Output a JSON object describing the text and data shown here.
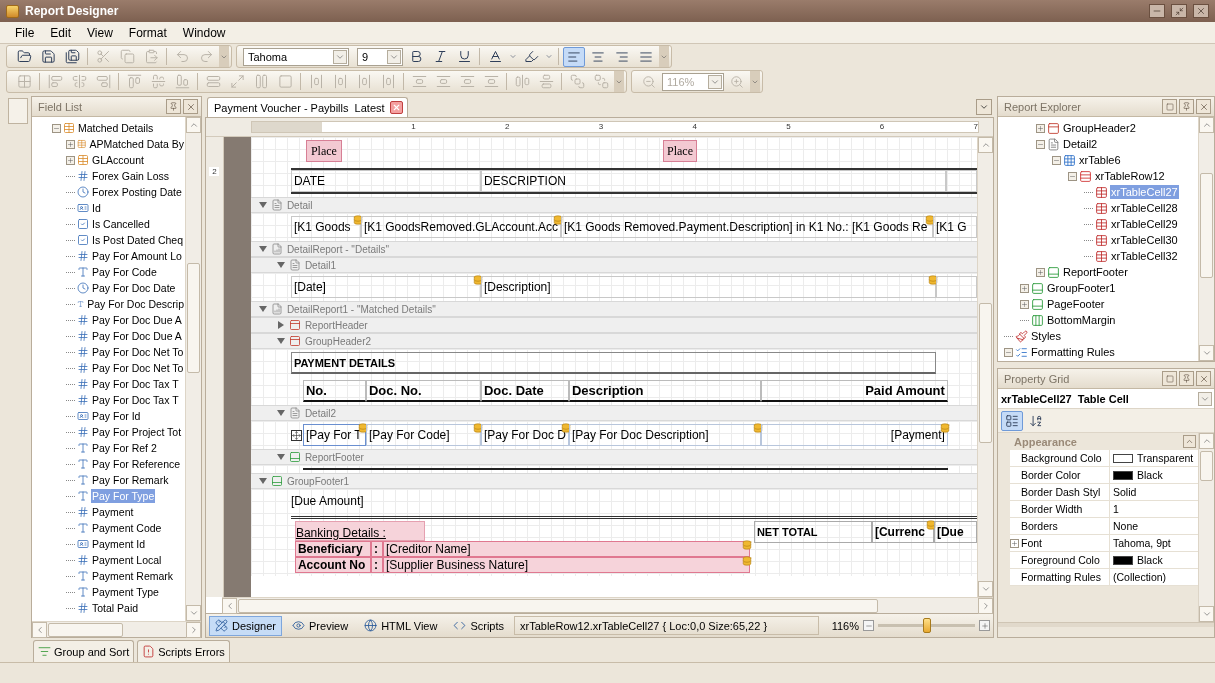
{
  "window": {
    "title": "Report Designer"
  },
  "menu": [
    "File",
    "Edit",
    "View",
    "Format",
    "Window"
  ],
  "file_tools": [
    {
      "kind": "open",
      "disabled": false
    },
    {
      "kind": "save",
      "disabled": false
    },
    {
      "kind": "save-all",
      "disabled": false
    },
    {
      "kind": "separator"
    },
    {
      "kind": "cut",
      "disabled": true
    },
    {
      "kind": "copy",
      "disabled": true
    },
    {
      "kind": "paste",
      "disabled": true
    },
    {
      "kind": "separator"
    },
    {
      "kind": "undo",
      "disabled": true
    },
    {
      "kind": "redo",
      "disabled": true
    }
  ],
  "font": {
    "name": "Tahoma",
    "size": "9"
  },
  "format_tools": [
    {
      "kind": "bold",
      "disabled": false
    },
    {
      "kind": "italic",
      "disabled": false
    },
    {
      "kind": "underline",
      "disabled": false
    },
    {
      "kind": "separator"
    },
    {
      "kind": "font-color",
      "disabled": false
    },
    {
      "kind": "dropdown",
      "disabled": false
    },
    {
      "kind": "back-color",
      "disabled": false
    },
    {
      "kind": "dropdown",
      "disabled": false
    },
    {
      "kind": "separator"
    }
  ],
  "alignment": [
    {
      "kind": "left",
      "selected": true
    },
    {
      "kind": "center",
      "selected": false
    },
    {
      "kind": "right",
      "selected": false
    },
    {
      "kind": "justify",
      "selected": false
    }
  ],
  "layout_tools": [
    {
      "kind": "grid",
      "disabled": true
    },
    {
      "kind": "separator"
    },
    {
      "kind": "align-left",
      "disabled": true
    },
    {
      "kind": "align-center",
      "disabled": true
    },
    {
      "kind": "align-right",
      "disabled": true
    },
    {
      "kind": "separator"
    },
    {
      "kind": "align-top",
      "disabled": true
    },
    {
      "kind": "align-middle",
      "disabled": true
    },
    {
      "kind": "align-bottom",
      "disabled": true
    },
    {
      "kind": "separator"
    },
    {
      "kind": "same-width",
      "disabled": true
    },
    {
      "kind": "size-grid",
      "disabled": true
    },
    {
      "kind": "same-height",
      "disabled": true
    },
    {
      "kind": "same-size",
      "disabled": true
    },
    {
      "kind": "separator"
    },
    {
      "kind": "h-space",
      "disabled": true
    },
    {
      "kind": "h-space",
      "disabled": true
    },
    {
      "kind": "h-space",
      "disabled": true
    },
    {
      "kind": "h-space",
      "disabled": true
    },
    {
      "kind": "separator"
    },
    {
      "kind": "v-space",
      "disabled": true
    },
    {
      "kind": "v-space",
      "disabled": true
    },
    {
      "kind": "v-space",
      "disabled": true
    },
    {
      "kind": "v-space",
      "disabled": true
    },
    {
      "kind": "separator"
    },
    {
      "kind": "center-h",
      "disabled": true
    },
    {
      "kind": "center-v",
      "disabled": true
    },
    {
      "kind": "separator"
    },
    {
      "kind": "front",
      "disabled": true
    },
    {
      "kind": "back",
      "disabled": true
    }
  ],
  "zoom_tool": {
    "value": "116%",
    "disabled": true
  },
  "field_list": {
    "title": "Field List",
    "tree": [
      {
        "label": "Matched Details",
        "kind": "table",
        "expanded": true,
        "selected": false,
        "children": [
          {
            "label": "APMatched Data By",
            "kind": "table",
            "expanded": false,
            "selected": false
          },
          {
            "label": "GLAccount",
            "kind": "table",
            "expanded": false,
            "selected": false
          },
          {
            "label": "Forex Gain Loss",
            "kind": "number",
            "selected": false
          },
          {
            "label": "Forex Posting Date",
            "kind": "date",
            "selected": false
          },
          {
            "label": "Id",
            "kind": "id",
            "selected": false
          },
          {
            "label": "Is Cancelled",
            "kind": "bool",
            "selected": false
          },
          {
            "label": "Is Post Dated Cheq",
            "kind": "bool",
            "selected": false
          },
          {
            "label": "Pay For Amount Lo",
            "kind": "number",
            "selected": false
          },
          {
            "label": "Pay For Code",
            "kind": "text",
            "selected": false
          },
          {
            "label": "Pay For Doc Date",
            "kind": "date",
            "selected": false
          },
          {
            "label": "Pay For Doc Descrip",
            "kind": "text",
            "selected": false
          },
          {
            "label": "Pay For Doc Due A",
            "kind": "number",
            "selected": false
          },
          {
            "label": "Pay For Doc Due A",
            "kind": "number",
            "selected": false
          },
          {
            "label": "Pay For Doc Net To",
            "kind": "number",
            "selected": false
          },
          {
            "label": "Pay For Doc Net To",
            "kind": "number",
            "selected": false
          },
          {
            "label": "Pay For Doc Tax T",
            "kind": "number",
            "selected": false
          },
          {
            "label": "Pay For Doc Tax T",
            "kind": "number",
            "selected": false
          },
          {
            "label": "Pay For Id",
            "kind": "id",
            "selected": false
          },
          {
            "label": "Pay For Project Tot",
            "kind": "number",
            "selected": false
          },
          {
            "label": "Pay For Ref 2",
            "kind": "text",
            "selected": false
          },
          {
            "label": "Pay For Reference",
            "kind": "text",
            "selected": false
          },
          {
            "label": "Pay For Remark",
            "kind": "text",
            "selected": false
          },
          {
            "label": "Pay For Type",
            "kind": "text",
            "selected": true
          },
          {
            "label": "Payment",
            "kind": "number",
            "selected": false
          },
          {
            "label": "Payment Code",
            "kind": "text",
            "selected": false
          },
          {
            "label": "Payment Id",
            "kind": "id",
            "selected": false
          },
          {
            "label": "Payment Local",
            "kind": "number",
            "selected": false
          },
          {
            "label": "Payment Remark",
            "kind": "text",
            "selected": false
          },
          {
            "label": "Payment Type",
            "kind": "text",
            "selected": false
          },
          {
            "label": "Total Paid",
            "kind": "number",
            "selected": false
          }
        ]
      }
    ]
  },
  "document_tab": {
    "title": "Payment Voucher - Paybills  Latest"
  },
  "ruler": [
    "1",
    "2",
    "3",
    "4",
    "5",
    "6",
    "7"
  ],
  "vertical_ruler": [
    "2"
  ],
  "bands": [
    {
      "kind": "page-header",
      "content": [
        {
          "kind": "places",
          "cells": [
            {
              "text": "Place"
            },
            {
              "text": "Place"
            }
          ]
        },
        {
          "kind": "header-table",
          "cells": [
            {
              "text": "DATE"
            },
            {
              "text": "DESCRIPTION"
            }
          ]
        }
      ]
    },
    {
      "caption": "Detail",
      "kind": "detail",
      "expanded": true,
      "content": [
        {
          "kind": "detail-row",
          "cells": [
            {
              "text": "[K1 Goods",
              "bound": true
            },
            {
              "text": "[K1 GoodsRemoved.GLAccount.Acc",
              "bound": true
            },
            {
              "text": "[K1 Goods Removed.Payment.Description] in K1 No.: [K1 Goods Re",
              "bound": true
            },
            {
              "text": "[K1 G",
              "bound": false
            }
          ]
        }
      ]
    },
    {
      "caption": "DetailReport - \"Details\"",
      "kind": "detail-report",
      "expanded": true,
      "children": [
        {
          "caption": "Detail1",
          "kind": "detail",
          "expanded": true,
          "content": [
            {
              "kind": "dates-row",
              "cells": [
                {
                  "text": "[Date]",
                  "bound": true
                },
                {
                  "text": "[Description]",
                  "bound": true
                }
              ]
            }
          ]
        }
      ]
    },
    {
      "caption": "DetailReport1 - \"Matched Details\"",
      "kind": "detail-report",
      "expanded": true,
      "children": [
        {
          "caption": "ReportHeader",
          "kind": "report-header",
          "expanded": false
        },
        {
          "caption": "GroupHeader2",
          "kind": "group-header",
          "expanded": true,
          "content": [
            {
              "kind": "title-box",
              "cells": [
                {
                  "text": "PAYMENT DETAILS"
                }
              ]
            },
            {
              "kind": "column-heads",
              "cells": [
                {
                  "text": "No."
                },
                {
                  "text": "Doc. No."
                },
                {
                  "text": "Doc. Date"
                },
                {
                  "text": "Description"
                },
                {
                  "text": "Paid Amount"
                }
              ]
            }
          ]
        },
        {
          "caption": "Detail2",
          "kind": "detail",
          "expanded": true,
          "content": [
            {
              "kind": "items-row",
              "cells": [
                {
                  "text": "[Pay For T",
                  "bound": true,
                  "selected": true
                },
                {
                  "text": "[Pay For Code]",
                  "bound": true,
                  "selected": false
                },
                {
                  "text": "[Pay For Doc D",
                  "bound": true,
                  "selected": false
                },
                {
                  "text": "[Pay For Doc Description]",
                  "bound": true,
                  "selected": false
                },
                {
                  "text": "[Payment]",
                  "bound": true,
                  "selected": false
                }
              ]
            }
          ]
        },
        {
          "caption": "ReportFooter",
          "kind": "report-footer",
          "expanded": true,
          "content": [
            {
              "kind": "rule"
            }
          ]
        }
      ]
    },
    {
      "caption": "GroupFooter1",
      "kind": "group-footer",
      "expanded": true,
      "content": [
        {
          "kind": "plain",
          "cells": [
            {
              "text": "[Due Amount]"
            }
          ]
        },
        {
          "kind": "banking",
          "lines": [
            {
              "kind": "heading",
              "cells": [
                {
                  "text": "Banking Details :"
                }
              ]
            },
            {
              "kind": "pair",
              "cells": [
                {
                  "text": "Beneficiary"
                },
                {
                  "text": ":"
                },
                {
                  "text": "[Creditor Name]",
                  "bound": true
                }
              ]
            },
            {
              "kind": "pair",
              "cells": [
                {
                  "text": "Account No"
                },
                {
                  "text": ":"
                },
                {
                  "text": "[Supplier Business Nature]",
                  "bound": true
                }
              ]
            }
          ],
          "cells": [
            {
              "text": "NET TOTAL",
              "bound": false
            },
            {
              "text": "[Currenc",
              "bound": true
            },
            {
              "text": "[Due",
              "bound": false
            }
          ]
        }
      ]
    }
  ],
  "view_tabs": [
    {
      "label": "Designer",
      "kind": "designer",
      "selected": true
    },
    {
      "label": "Preview",
      "kind": "preview",
      "selected": false
    },
    {
      "label": "HTML View",
      "kind": "html",
      "selected": false
    },
    {
      "label": "Scripts",
      "kind": "scripts",
      "selected": false
    }
  ],
  "status": "xrTableRow12.xrTableCell27 { Loc:0,0 Size:65,22 }",
  "zoom": {
    "value": "116%",
    "level": 0.5
  },
  "explorer": {
    "title": "Report Explorer",
    "tree": [
      {
        "children": [
          {
            "children": [
              {
                "label": "GroupHeader2",
                "kind": "group-header",
                "expanded": false,
                "selected": false
              },
              {
                "label": "Detail2",
                "kind": "detail",
                "expanded": true,
                "selected": false,
                "children": [
                  {
                    "label": "xrTable6",
                    "kind": "table",
                    "expanded": true,
                    "selected": false,
                    "children": [
                      {
                        "label": "xrTableRow12",
                        "kind": "row",
                        "expanded": true,
                        "selected": false,
                        "children": [
                          {
                            "label": "xrTableCell27",
                            "kind": "cell",
                            "selected": true
                          },
                          {
                            "label": "xrTableCell28",
                            "kind": "cell",
                            "selected": false
                          },
                          {
                            "label": "xrTableCell29",
                            "kind": "cell",
                            "selected": false
                          },
                          {
                            "label": "xrTableCell30",
                            "kind": "cell",
                            "selected": false
                          },
                          {
                            "label": "xrTableCell32",
                            "kind": "cell",
                            "selected": false
                          }
                        ]
                      }
                    ]
                  }
                ]
              },
              {
                "label": "ReportFooter",
                "kind": "report-footer",
                "expanded": false,
                "selected": false
              }
            ]
          },
          {
            "label": "GroupFooter1",
            "kind": "group-footer",
            "expanded": false,
            "selected": false
          },
          {
            "label": "PageFooter",
            "kind": "page-footer",
            "expanded": false,
            "selected": false
          },
          {
            "label": "BottomMargin",
            "kind": "margin",
            "selected": false
          }
        ]
      },
      {
        "label": "Styles",
        "kind": "styles",
        "selected": false
      },
      {
        "label": "Formatting Rules",
        "kind": "rules",
        "expanded": true,
        "selected": false
      }
    ]
  },
  "properties": {
    "title": "Property Grid",
    "object": "xrTableCell27",
    "object_type": "Table Cell",
    "sort_modes": [
      {
        "kind": "categorized",
        "selected": true
      },
      {
        "kind": "alphabetical",
        "selected": false
      }
    ],
    "category": {
      "label": "Appearance",
      "expanded": true
    },
    "rows": [
      {
        "name": "Background Colo",
        "value": "Transparent",
        "color": "#ffffff"
      },
      {
        "name": "Border Color",
        "value": "Black",
        "color": "#000000"
      },
      {
        "name": "Border Dash Styl",
        "value": "Solid"
      },
      {
        "name": "Border Width",
        "value": "1"
      },
      {
        "name": "Borders",
        "value": "None"
      },
      {
        "name": "Font",
        "value": "Tahoma, 9pt",
        "expanded": false
      },
      {
        "name": "Foreground Colo",
        "value": "Black",
        "color": "#000000"
      },
      {
        "name": "Formatting Rules",
        "value": "(Collection)"
      }
    ]
  },
  "panel_tabs": [
    {
      "label": "Group and Sort",
      "kind": "group-sort"
    },
    {
      "label": "Scripts Errors",
      "kind": "errors"
    }
  ]
}
